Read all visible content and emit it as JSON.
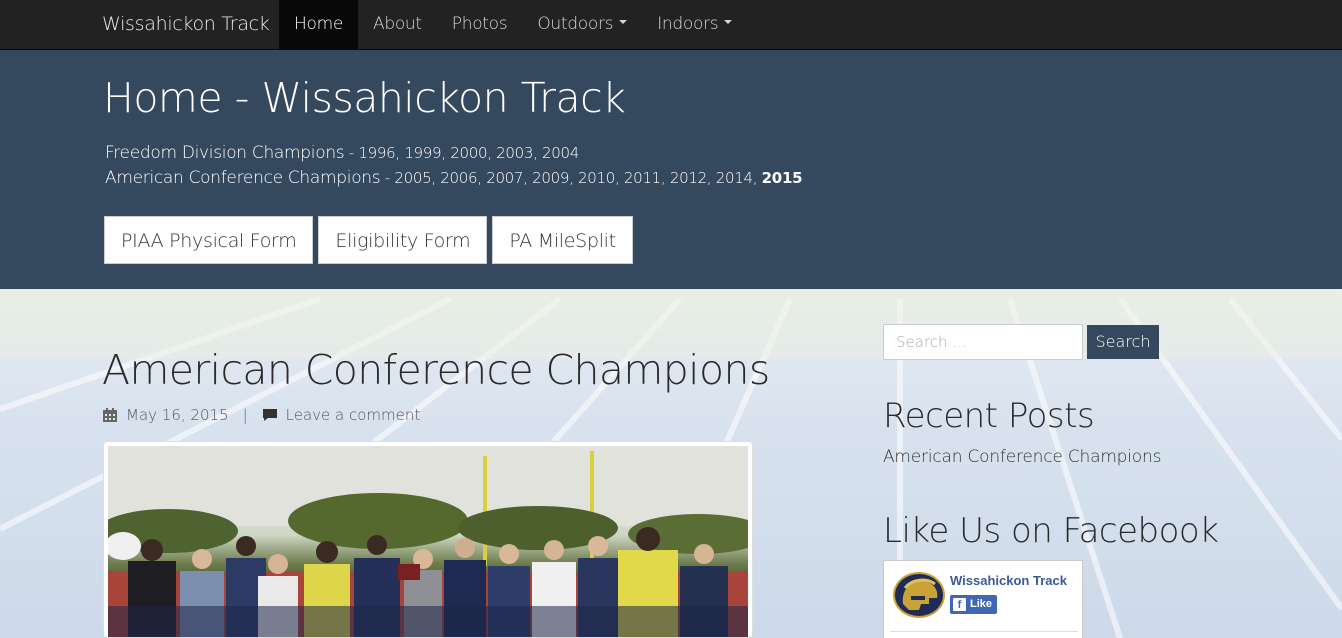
{
  "navbar": {
    "brand": "Wissahickon Track",
    "items": [
      {
        "label": "Home",
        "active": true,
        "dropdown": false
      },
      {
        "label": "About",
        "active": false,
        "dropdown": false
      },
      {
        "label": "Photos",
        "active": false,
        "dropdown": false
      },
      {
        "label": "Outdoors",
        "active": false,
        "dropdown": true
      },
      {
        "label": "Indoors",
        "active": false,
        "dropdown": true
      }
    ]
  },
  "jumbotron": {
    "title": "Home - Wissahickon Track",
    "freedom_label": "Freedom Division Champions",
    "freedom_years": " - 1996, 1999, 2000, 2003, 2004",
    "american_label": "American Conference Champions",
    "american_years": " - 2005, 2006, 2007, 2009, 2010, 2011, 2012, 2014, ",
    "american_highlight": "2015",
    "buttons": [
      "PIAA Physical Form",
      "Eligibility Form",
      "PA MileSplit"
    ],
    "background": "#34495e"
  },
  "post": {
    "title": "American Conference Champions",
    "date": "May 16, 2015",
    "separator": "|",
    "comment_link": "Leave a comment"
  },
  "sidebar": {
    "search_placeholder": "Search …",
    "search_button": "Search",
    "recent_posts_title": "Recent Posts",
    "recent_posts": [
      "American Conference Champions"
    ],
    "facebook_title": "Like Us on Facebook",
    "facebook_page_name": "Wissahickon Track",
    "facebook_like": "Like"
  },
  "icons": {
    "date": "calendar-icon",
    "comment": "comment-icon",
    "caret": "caret-down-icon"
  },
  "colors": {
    "navbar": "#222222",
    "accent": "#34495e",
    "facebook": "#4267b2"
  }
}
